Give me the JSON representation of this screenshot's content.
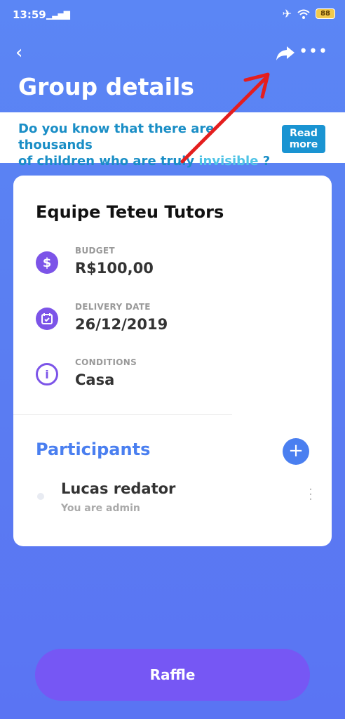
{
  "status": {
    "time": "13:59",
    "signal": "▁▃▅▇",
    "battery": "88"
  },
  "header": {
    "back_icon": "‹",
    "more_icon": "•••",
    "title": "Group details"
  },
  "banner": {
    "line1": "Do you know that there are thousands",
    "line2_a": "of children who are truly ",
    "line2_highlight": "invisible",
    "line2_b": " ?",
    "read_more": "Read more"
  },
  "group": {
    "name": "Equipe Teteu Tutors",
    "budget_label": "BUDGET",
    "budget_value": "R$100,00",
    "delivery_label": "DELIVERY DATE",
    "delivery_value": "26/12/2019",
    "conditions_label": "CONDITIONS",
    "conditions_value": "Casa"
  },
  "participants": {
    "title": "Participants",
    "add_icon": "+",
    "items": [
      {
        "name": "Lucas redator",
        "role": "You are admin"
      }
    ]
  },
  "raffle_label": "Raffle",
  "colors": {
    "accent": "#4a7ff0",
    "purple": "#7657f4",
    "annotation_arrow": "#e41e1e"
  }
}
